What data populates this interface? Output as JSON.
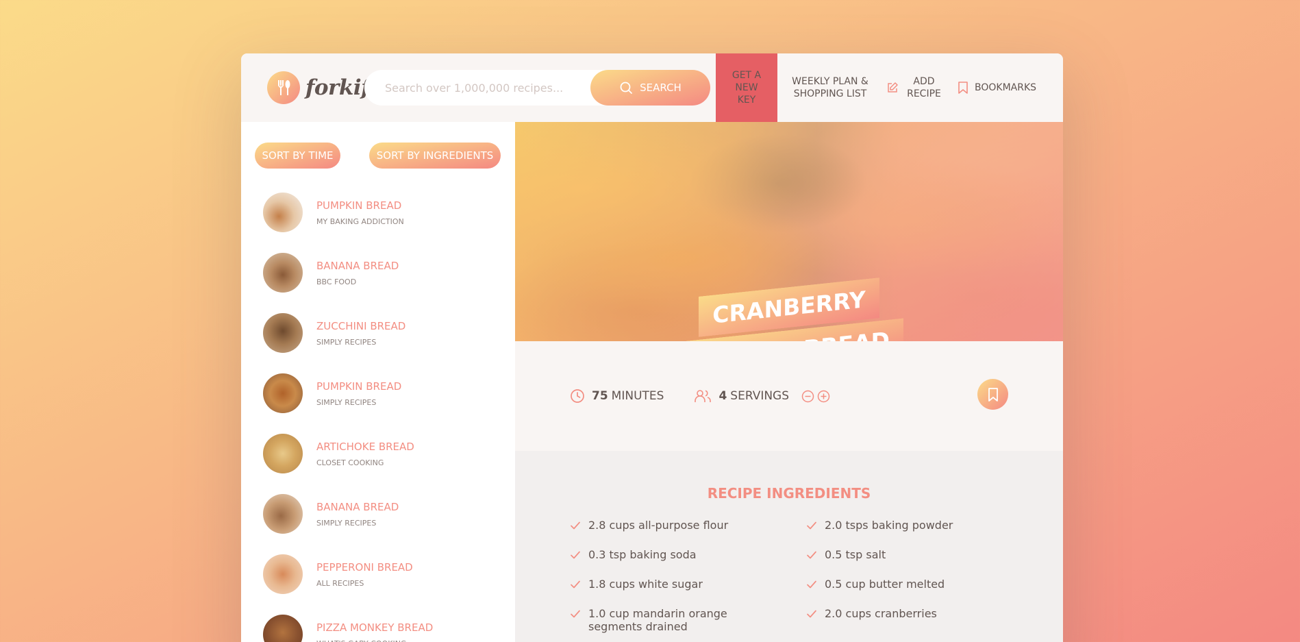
{
  "header": {
    "logo_text": "forkify",
    "search_placeholder": "Search over 1,000,000 recipes...",
    "search_button": "Search",
    "nav": {
      "key_label": "Get a new key",
      "weekly_label": "Weekly plan & shopping list",
      "add_recipe_label": "Add recipe",
      "bookmarks_label": "Bookmarks"
    }
  },
  "sidebar": {
    "sort_time": "Sort by time",
    "sort_ingredients": "Sort by ingredients",
    "results": [
      {
        "title": "Pumpkin Bread",
        "publisher": "My Baking Addiction"
      },
      {
        "title": "Banana Bread",
        "publisher": "BBC Food"
      },
      {
        "title": "Zucchini Bread",
        "publisher": "Simply Recipes"
      },
      {
        "title": "Pumpkin Bread",
        "publisher": "Simply Recipes"
      },
      {
        "title": "Artichoke Bread",
        "publisher": "Closet Cooking"
      },
      {
        "title": "Banana Bread",
        "publisher": "Simply Recipes"
      },
      {
        "title": "Pepperoni Bread",
        "publisher": "All Recipes"
      },
      {
        "title": "Pizza Monkey Bread",
        "publisher": "What's Gaby Cooking"
      }
    ]
  },
  "recipe": {
    "title": "Cranberry Orange Bread",
    "minutes": "75",
    "minutes_label": "minutes",
    "servings": "4",
    "servings_label": "servings",
    "ingredients_heading": "Recipe ingredients",
    "ingredients": [
      "2.8 cups all-purpose flour",
      "2.0 tsps baking powder",
      "0.3 tsp baking soda",
      "0.5 tsp salt",
      "1.8 cups white sugar",
      "0.5 cup butter melted",
      "1.0 cup mandarin orange segments drained",
      "2.0 cups cranberries"
    ]
  },
  "colors": {
    "accent": "#f38e82",
    "gradient_start": "#fbdb89",
    "gradient_end": "#f48982",
    "key_red": "#e55f64",
    "text": "#615551"
  }
}
